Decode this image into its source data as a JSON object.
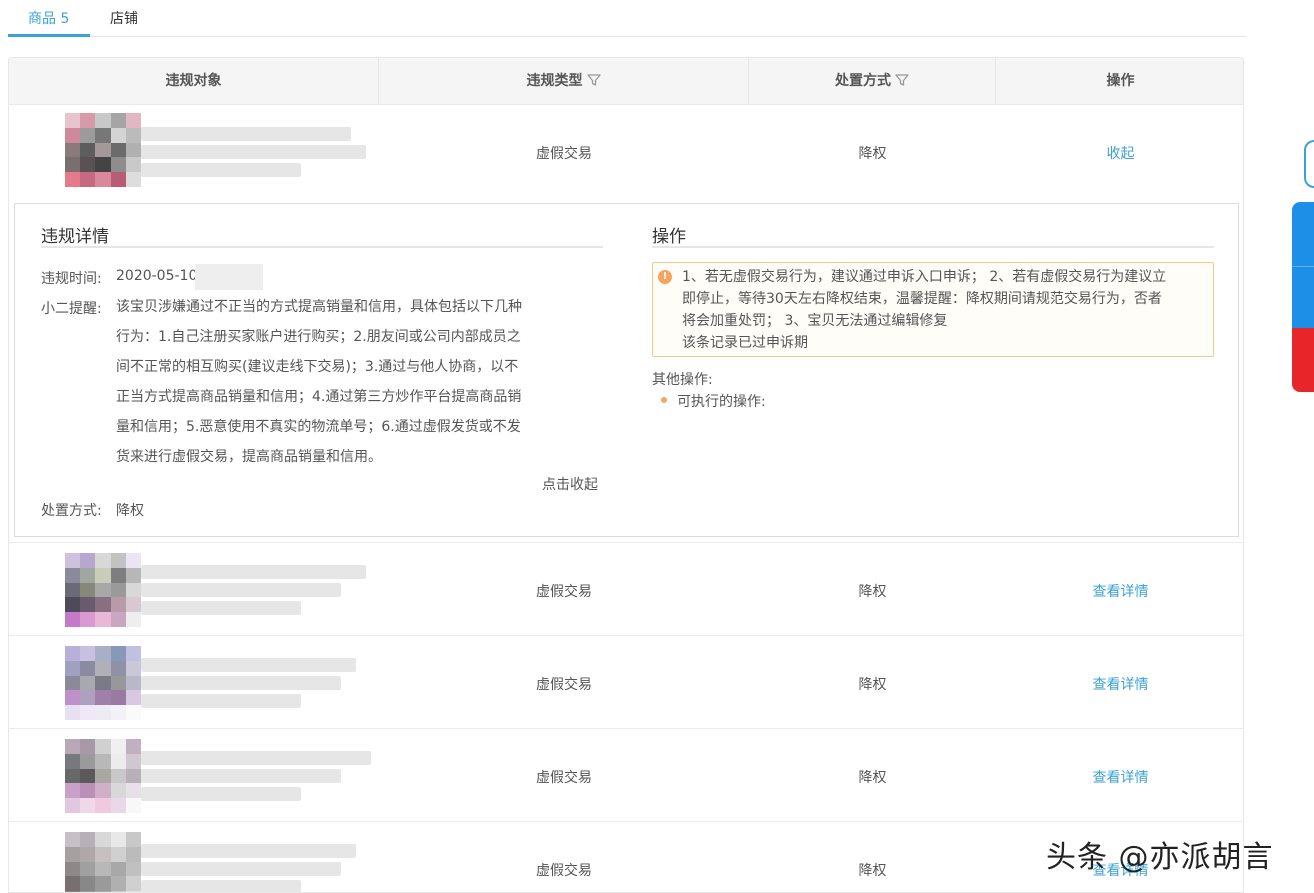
{
  "tabs": [
    {
      "label": "商品 5",
      "active": true
    },
    {
      "label": "店铺",
      "active": false
    }
  ],
  "columns": [
    {
      "label": "违规对象",
      "filter": false
    },
    {
      "label": "违规类型",
      "filter": true
    },
    {
      "label": "处置方式",
      "filter": true
    },
    {
      "label": "操作",
      "filter": false
    }
  ],
  "rows": [
    {
      "type": "虚假交易",
      "action": "降权",
      "op": "收起"
    },
    {
      "type": "虚假交易",
      "action": "降权",
      "op": "查看详情"
    },
    {
      "type": "虚假交易",
      "action": "降权",
      "op": "查看详情"
    },
    {
      "type": "虚假交易",
      "action": "降权",
      "op": "查看详情"
    },
    {
      "type": "虚假交易",
      "action": "降权",
      "op": "查看详情"
    }
  ],
  "detail": {
    "title": "违规详情",
    "time_label": "违规时间:",
    "time_value": "2020-05-10",
    "reminder_label": "小二提醒:",
    "reminder_lines": [
      "该宝贝涉嫌通过不正当的方式提高销量和信用，具体包括以下几种",
      "行为：1.自己注册买家账户进行购买；2.朋友间或公司内部成员之",
      "间不正常的相互购买(建议走线下交易)；3.通过与他人协商，以不",
      "正当方式提高商品销量和信用；4.通过第三方炒作平台提高商品销",
      "量和信用；5.恶意使用不真实的物流单号；6.通过虚假发货或不发",
      "货来进行虚假交易，提高商品销量和信用。"
    ],
    "collapse_link": "点击收起",
    "disposal_label": "处置方式:",
    "disposal_value": "降权"
  },
  "operation": {
    "title": "操作",
    "notice_icon": "!",
    "notice_lines": [
      "1、若无虚假交易行为，建议通过申诉入口申诉； 2、若有虚假交易行为建议立",
      "即停止，等待30天左右降权结束，温馨提醒：降权期间请规范交易行为，否者",
      "将会加重处罚； 3、宝贝无法通过编辑修复",
      "该条记录已过申诉期"
    ],
    "other_label": "其他操作:",
    "executable_label": "可执行的操作:"
  },
  "watermark": "头条 @亦派胡言",
  "colors": {
    "accent": "#3ba2d7",
    "notice_border": "#f5c88e",
    "notice_icon": "#f4a460",
    "float_blue": "#1e8fe6",
    "float_red": "#e8262a"
  }
}
